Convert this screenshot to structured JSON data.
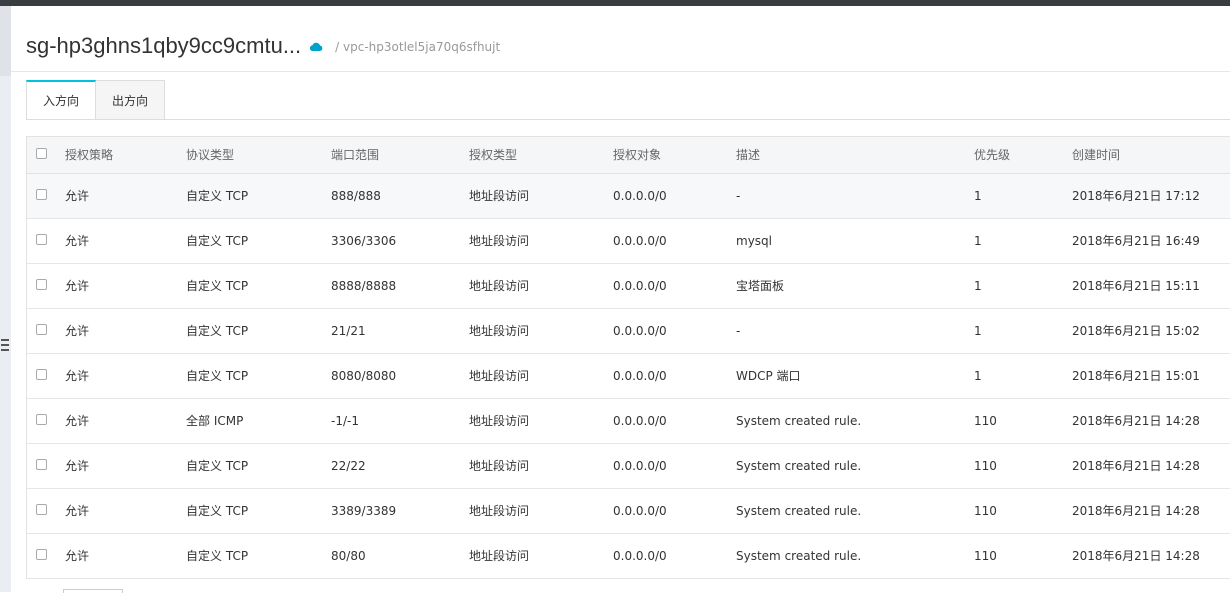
{
  "header": {
    "title": "sg-hp3ghns1qby9cc9cmtu...",
    "vpc": "/ vpc-hp3otlel5ja70q6sfhujt",
    "cloud_icon": "cloud-icon",
    "accent": "#00c1de"
  },
  "tabs": [
    {
      "label": "入方向",
      "active": true
    },
    {
      "label": "出方向",
      "active": false
    }
  ],
  "table": {
    "columns": [
      "授权策略",
      "协议类型",
      "端口范围",
      "授权类型",
      "授权对象",
      "描述",
      "优先级",
      "创建时间"
    ],
    "rows": [
      [
        "允许",
        "自定义 TCP",
        "888/888",
        "地址段访问",
        "0.0.0.0/0",
        "-",
        "1",
        "2018年6月21日 17:12"
      ],
      [
        "允许",
        "自定义 TCP",
        "3306/3306",
        "地址段访问",
        "0.0.0.0/0",
        "mysql",
        "1",
        "2018年6月21日 16:49"
      ],
      [
        "允许",
        "自定义 TCP",
        "8888/8888",
        "地址段访问",
        "0.0.0.0/0",
        "宝塔面板",
        "1",
        "2018年6月21日 15:11"
      ],
      [
        "允许",
        "自定义 TCP",
        "21/21",
        "地址段访问",
        "0.0.0.0/0",
        "-",
        "1",
        "2018年6月21日 15:02"
      ],
      [
        "允许",
        "自定义 TCP",
        "8080/8080",
        "地址段访问",
        "0.0.0.0/0",
        "WDCP 端口",
        "1",
        "2018年6月21日 15:01"
      ],
      [
        "允许",
        "全部 ICMP",
        "-1/-1",
        "地址段访问",
        "0.0.0.0/0",
        "System created rule.",
        "110",
        "2018年6月21日 14:28"
      ],
      [
        "允许",
        "自定义 TCP",
        "22/22",
        "地址段访问",
        "0.0.0.0/0",
        "System created rule.",
        "110",
        "2018年6月21日 14:28"
      ],
      [
        "允许",
        "自定义 TCP",
        "3389/3389",
        "地址段访问",
        "0.0.0.0/0",
        "System created rule.",
        "110",
        "2018年6月21日 14:28"
      ],
      [
        "允许",
        "自定义 TCP",
        "80/80",
        "地址段访问",
        "0.0.0.0/0",
        "System created rule.",
        "110",
        "2018年6月21日 14:28"
      ]
    ]
  }
}
